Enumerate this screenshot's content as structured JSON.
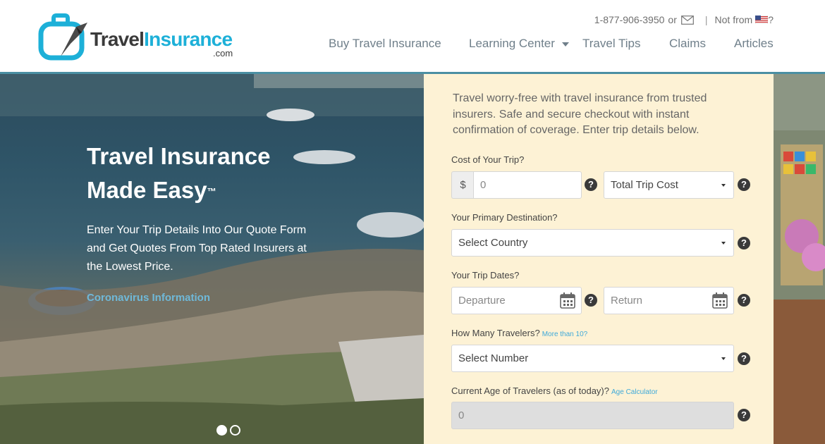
{
  "header": {
    "logo": {
      "word1": "Travel",
      "word2": "Insurance",
      "suffix": ".com"
    },
    "topbar": {
      "phone": "1-877-906-3950",
      "or": "or",
      "not_from": "Not from",
      "question": "?"
    },
    "nav": [
      {
        "label": "Buy Travel Insurance"
      },
      {
        "label": "Learning Center"
      },
      {
        "label": "Travel Tips"
      },
      {
        "label": "Claims"
      },
      {
        "label": "Articles"
      }
    ]
  },
  "hero": {
    "title_line1": "Travel Insurance",
    "title_line2": "Made Easy",
    "trademark": "™",
    "subtitle": "Enter Your Trip Details Into Our Quote Form and Get Quotes From Top Rated Insurers at the Lowest Price.",
    "link": "Coronavirus Information"
  },
  "form": {
    "intro": "Travel worry-free with travel insurance from trusted insurers. Safe and secure checkout with instant confirmation of coverage. Enter trip details below.",
    "cost": {
      "label": "Cost of Your Trip?",
      "prefix": "$",
      "value": "0",
      "type_selected": "Total Trip Cost"
    },
    "destination": {
      "label": "Your Primary Destination?",
      "selected": "Select Country"
    },
    "dates": {
      "label": "Your Trip Dates?",
      "departure_placeholder": "Departure",
      "return_placeholder": "Return"
    },
    "travelers": {
      "label": "How Many Travelers?",
      "more_link": "More than 10?",
      "selected": "Select Number"
    },
    "ages": {
      "label": "Current Age of Travelers (as of today)?",
      "calc_link": "Age Calculator",
      "value": "0"
    },
    "help_symbol": "?"
  },
  "colors": {
    "accent": "#1db0d8",
    "panel_bg": "#fdf2d5",
    "header_line": "#4a8fa3",
    "link": "#3fa9d9"
  }
}
